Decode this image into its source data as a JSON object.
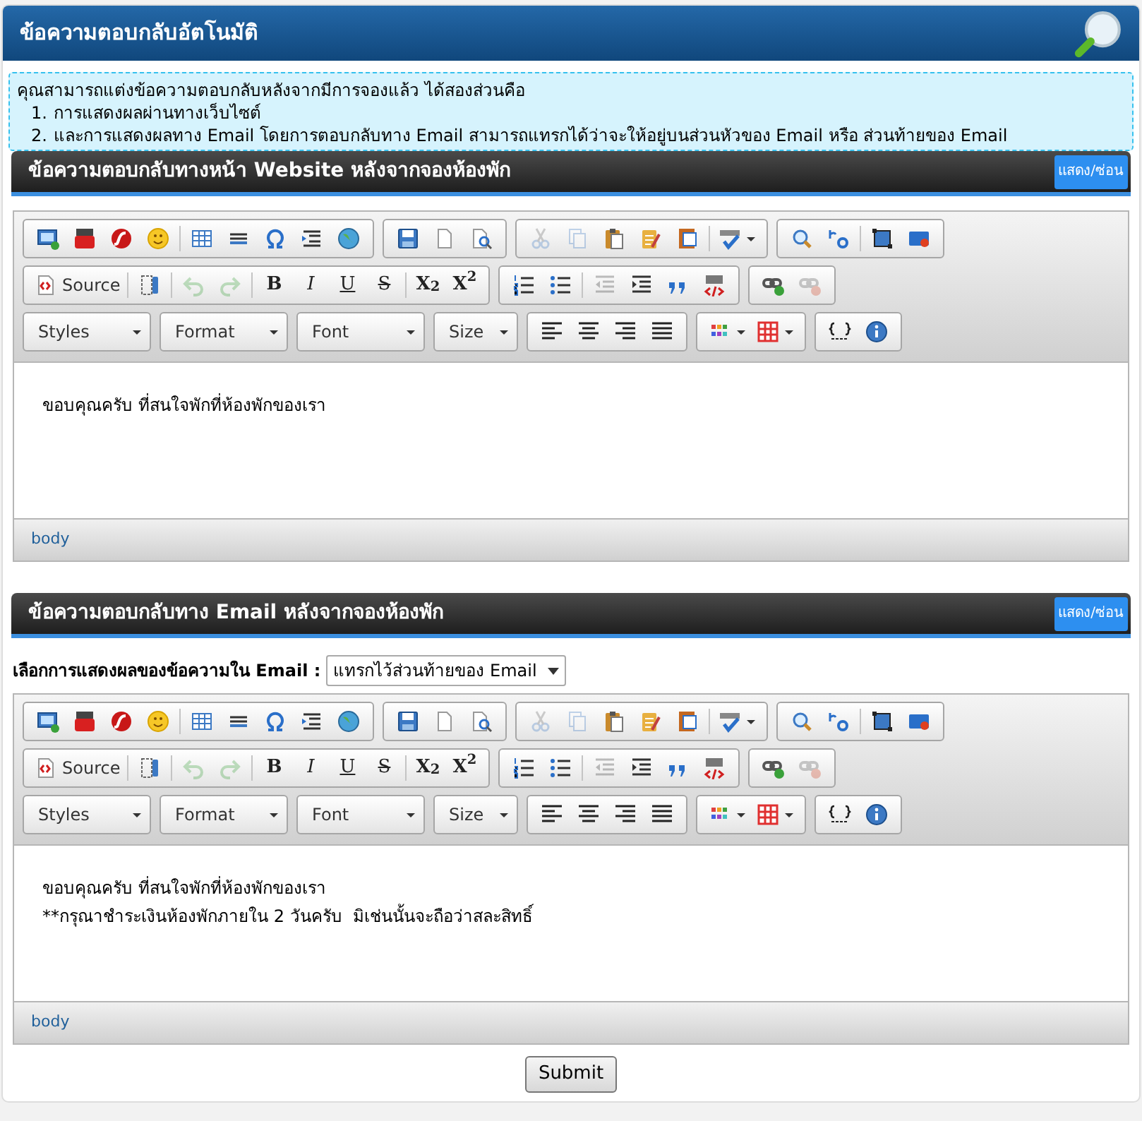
{
  "page_title": "ข้อความตอบกลับอัตโนมัติ",
  "info": {
    "intro": "คุณสามารถแต่งข้อความตอบกลับหลังจากมีการจองแล้ว ได้สองส่วนคือ",
    "items": [
      {
        "marker": "1.",
        "text": "การแสดงผลผ่านทางเว็บไซต์"
      },
      {
        "marker": "2.",
        "text": "และการแสดงผลทาง Email โดยการตอบกลับทาง Email สามารถแทรกได้ว่าจะให้อยู่บนส่วนหัวของ Email หรือ ส่วนท้ายของ Email"
      }
    ]
  },
  "sections": [
    {
      "title": "ข้อความตอบกลับทางหน้า Website หลังจากจองห้องพัก",
      "toggle_label": "แสดง/ซ่อน",
      "editor": {
        "toolbar": [
          [
            [
              {
                "kind": "icon",
                "disabled": false
              },
              {
                "kind": "icon",
                "disabled": false
              },
              {
                "kind": "icon",
                "disabled": false
              },
              {
                "kind": "icon",
                "disabled": false
              },
              {
                "kind": "sep"
              },
              {
                "kind": "icon",
                "disabled": false
              },
              {
                "kind": "icon",
                "disabled": false
              },
              {
                "kind": "icon",
                "disabled": false
              },
              {
                "kind": "icon",
                "disabled": false
              },
              {
                "kind": "icon",
                "disabled": false
              }
            ],
            [
              {
                "kind": "icon",
                "disabled": false
              },
              {
                "kind": "icon",
                "disabled": false
              },
              {
                "kind": "icon",
                "disabled": false
              }
            ],
            [
              {
                "kind": "icon",
                "disabled": true
              },
              {
                "kind": "icon",
                "disabled": true
              },
              {
                "kind": "icon",
                "disabled": false
              },
              {
                "kind": "icon",
                "disabled": false
              },
              {
                "kind": "icon",
                "disabled": false
              },
              {
                "kind": "sep"
              },
              {
                "kind": "menu",
                "disabled": false
              }
            ],
            [
              {
                "kind": "icon",
                "disabled": false
              },
              {
                "kind": "icon",
                "disabled": false
              },
              {
                "kind": "sep"
              },
              {
                "kind": "icon",
                "disabled": false
              },
              {
                "kind": "icon",
                "disabled": false
              }
            ]
          ],
          [
            [
              {
                "kind": "source",
                "label": "Source"
              },
              {
                "kind": "sep"
              },
              {
                "kind": "icon",
                "disabled": false
              },
              {
                "kind": "sep"
              },
              {
                "kind": "icon",
                "disabled": true
              },
              {
                "kind": "icon",
                "disabled": true
              },
              {
                "kind": "sep"
              },
              {
                "kind": "glyph",
                "label": "B"
              },
              {
                "kind": "glyph",
                "label": "I"
              },
              {
                "kind": "glyph",
                "label": "U"
              },
              {
                "kind": "glyph",
                "label": "S"
              },
              {
                "kind": "sep"
              },
              {
                "kind": "glyph",
                "label": "X$_{2}$"
              },
              {
                "kind": "glyph",
                "label": "X$^{2}$"
              }
            ],
            [
              {
                "kind": "icon",
                "disabled": false
              },
              {
                "kind": "icon",
                "disabled": false
              },
              {
                "kind": "sep"
              },
              {
                "kind": "icon",
                "disabled": true
              },
              {
                "kind": "icon",
                "disabled": false
              },
              {
                "kind": "icon",
                "disabled": false
              },
              {
                "kind": "icon",
                "disabled": false
              }
            ],
            [
              {
                "kind": "icon",
                "disabled": false
              },
              {
                "kind": "icon",
                "disabled": true
              }
            ]
          ],
          [
            [
              {
                "kind": "combo",
                "label": "Styles"
              }
            ],
            [
              {
                "kind": "combo",
                "label": "Format"
              }
            ],
            [
              {
                "kind": "combo",
                "label": "Font"
              }
            ],
            [
              {
                "kind": "combo",
                "label": "Size"
              }
            ],
            [
              {
                "kind": "icon",
                "disabled": false
              },
              {
                "kind": "icon",
                "disabled": false
              },
              {
                "kind": "icon",
                "disabled": false
              },
              {
                "kind": "icon",
                "disabled": false
              }
            ],
            [
              {
                "kind": "menu",
                "disabled": false
              },
              {
                "kind": "menu",
                "disabled": false
              }
            ],
            [
              {
                "kind": "icon",
                "disabled": false
              },
              {
                "kind": "icon",
                "disabled": false
              }
            ]
          ]
        ],
        "content": [
          "ขอบคุณครับ ที่สนใจพักที่ห้องพักของเรา"
        ],
        "path": "body"
      }
    },
    {
      "title": "ข้อความตอบกลับทาง Email หลังจากจองห้องพัก",
      "toggle_label": "แสดง/ซ่อน",
      "display_option": {
        "label": "เลือกการแสดงผลของข้อความใน Email :",
        "value": "แทรกไว้ส่วนท้ายของ Email"
      },
      "editor": {
        "toolbar": [
          [
            [
              {
                "kind": "icon",
                "disabled": false
              },
              {
                "kind": "icon",
                "disabled": false
              },
              {
                "kind": "icon",
                "disabled": false
              },
              {
                "kind": "icon",
                "disabled": false
              },
              {
                "kind": "sep"
              },
              {
                "kind": "icon",
                "disabled": false
              },
              {
                "kind": "icon",
                "disabled": false
              },
              {
                "kind": "icon",
                "disabled": false
              },
              {
                "kind": "icon",
                "disabled": false
              },
              {
                "kind": "icon",
                "disabled": false
              }
            ],
            [
              {
                "kind": "icon",
                "disabled": false
              },
              {
                "kind": "icon",
                "disabled": false
              },
              {
                "kind": "icon",
                "disabled": false
              }
            ],
            [
              {
                "kind": "icon",
                "disabled": true
              },
              {
                "kind": "icon",
                "disabled": true
              },
              {
                "kind": "icon",
                "disabled": false
              },
              {
                "kind": "icon",
                "disabled": false
              },
              {
                "kind": "icon",
                "disabled": false
              },
              {
                "kind": "sep"
              },
              {
                "kind": "menu",
                "disabled": false
              }
            ],
            [
              {
                "kind": "icon",
                "disabled": false
              },
              {
                "kind": "icon",
                "disabled": false
              },
              {
                "kind": "sep"
              },
              {
                "kind": "icon",
                "disabled": false
              },
              {
                "kind": "icon",
                "disabled": false
              }
            ]
          ],
          [
            [
              {
                "kind": "source",
                "label": "Source"
              },
              {
                "kind": "sep"
              },
              {
                "kind": "icon",
                "disabled": false
              },
              {
                "kind": "sep"
              },
              {
                "kind": "icon",
                "disabled": true
              },
              {
                "kind": "icon",
                "disabled": true
              },
              {
                "kind": "sep"
              },
              {
                "kind": "glyph",
                "label": "B"
              },
              {
                "kind": "glyph",
                "label": "I"
              },
              {
                "kind": "glyph",
                "label": "U"
              },
              {
                "kind": "glyph",
                "label": "S"
              },
              {
                "kind": "sep"
              },
              {
                "kind": "glyph",
                "label": "X$_{2}$"
              },
              {
                "kind": "glyph",
                "label": "X$^{2}$"
              }
            ],
            [
              {
                "kind": "icon",
                "disabled": false
              },
              {
                "kind": "icon",
                "disabled": false
              },
              {
                "kind": "sep"
              },
              {
                "kind": "icon",
                "disabled": true
              },
              {
                "kind": "icon",
                "disabled": false
              },
              {
                "kind": "icon",
                "disabled": false
              },
              {
                "kind": "icon",
                "disabled": false
              }
            ],
            [
              {
                "kind": "icon",
                "disabled": false
              },
              {
                "kind": "icon",
                "disabled": true
              }
            ]
          ],
          [
            [
              {
                "kind": "combo",
                "label": "Styles"
              }
            ],
            [
              {
                "kind": "combo",
                "label": "Format"
              }
            ],
            [
              {
                "kind": "combo",
                "label": "Font"
              }
            ],
            [
              {
                "kind": "combo",
                "label": "Size"
              }
            ],
            [
              {
                "kind": "icon",
                "disabled": false
              },
              {
                "kind": "icon",
                "disabled": false
              },
              {
                "kind": "icon",
                "disabled": false
              },
              {
                "kind": "icon",
                "disabled": false
              }
            ],
            [
              {
                "kind": "menu",
                "disabled": false
              },
              {
                "kind": "menu",
                "disabled": false
              }
            ],
            [
              {
                "kind": "icon",
                "disabled": false
              },
              {
                "kind": "icon",
                "disabled": false
              }
            ]
          ]
        ],
        "content": [
          "ขอบคุณครับ ที่สนใจพักที่ห้องพักของเรา",
          "**กรุณาชำระเงินห้องพักภายใน 2 วันครับ  มิเช่นนั้นจะถือว่าสละสิทธิ์"
        ],
        "path": "body"
      }
    }
  ],
  "submit": "Submit"
}
